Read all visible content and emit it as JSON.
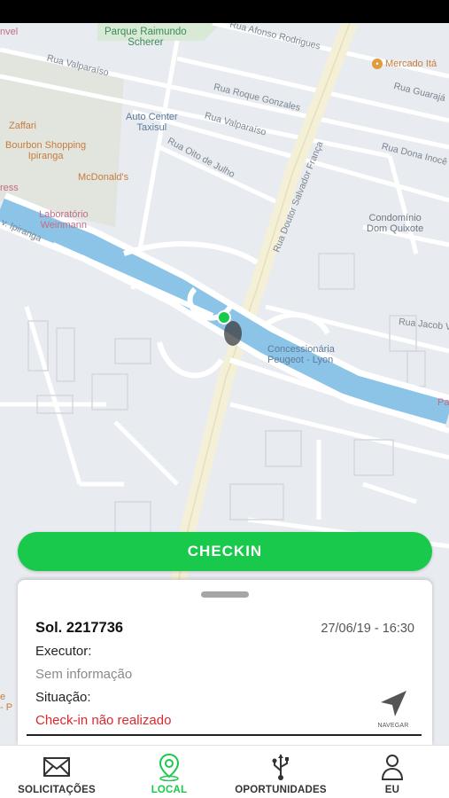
{
  "map": {
    "labels": {
      "park": "Parque Raimundo\nScherer",
      "rua_afonso": "Rua Afonso Rodrigues",
      "mercado": "Mercado Itá",
      "rua_valparaiso_1": "Rua Valparaíso",
      "rua_roque": "Rua Roque Gonzales",
      "rua_guaraja": "Rua Guarajá",
      "auto_center": "Auto Center\nTaxisul",
      "rua_valparaiso_2": "Rua Valparaíso",
      "zaffari": "Zaffari",
      "bourbon": "Bourbon Shopping\nIpiranga",
      "rua_dona_inoce": "Rua Dona Inocê",
      "rua_doutor": "Rua Doutor Salvador França",
      "rua_oito": "Rua Oito de Julho",
      "mcdonalds": "McDonald's",
      "press": "ress",
      "laboratorio": "Laboratório\nWeinmann",
      "condominio": "Condomínio\nDom Quixote",
      "ipiranga": "v. Ipiranga",
      "rua_jacob": "Rua Jacob V",
      "concessionaria": "Concessionária\nPeugeot - Lyon",
      "nvel": "nvel",
      "pa": "Pa",
      "left_edge": "e\n- P"
    }
  },
  "checkin_button": {
    "label": "CHECKIN"
  },
  "card": {
    "sol": "Sol. 2217736",
    "date": "27/06/19 - 16:30",
    "executor_label": "Executor:",
    "executor_value": "Sem informação",
    "situacao_label": "Situação:",
    "situacao_value": "Check-in não realizado",
    "navegar_label": "NAVEGAR"
  },
  "bottom_nav": {
    "tabs": [
      {
        "label": "SOLICITAÇÕES",
        "icon": "envelope-icon",
        "active": false
      },
      {
        "label": "LOCAL",
        "icon": "map-pin-icon",
        "active": true
      },
      {
        "label": "OPORTUNIDADES",
        "icon": "usb-icon",
        "active": false
      },
      {
        "label": "EU",
        "icon": "user-icon",
        "active": false
      }
    ]
  },
  "colors": {
    "accent": "#18c94b",
    "error": "#e0262b",
    "river": "#8cc4e8"
  }
}
